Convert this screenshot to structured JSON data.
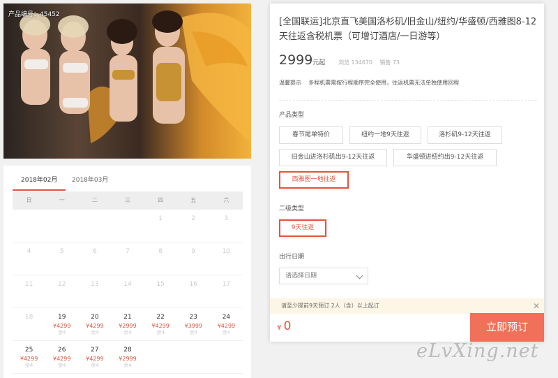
{
  "hero": {
    "product_code": "产品编号：45452"
  },
  "calendar": {
    "tabs": [
      "2018年02月",
      "2018年03月"
    ],
    "weekdays": [
      "日",
      "一",
      "二",
      "三",
      "四",
      "五",
      "六"
    ],
    "rows": [
      [
        {
          "d": ""
        },
        {
          "d": ""
        },
        {
          "d": ""
        },
        {
          "d": ""
        },
        {
          "d": "1"
        },
        {
          "d": "2"
        },
        {
          "d": "3"
        }
      ],
      [
        {
          "d": "4"
        },
        {
          "d": "5"
        },
        {
          "d": "6"
        },
        {
          "d": "7"
        },
        {
          "d": "8"
        },
        {
          "d": "9"
        },
        {
          "d": "10"
        }
      ],
      [
        {
          "d": "11"
        },
        {
          "d": "12"
        },
        {
          "d": "13"
        },
        {
          "d": "14"
        },
        {
          "d": "15"
        },
        {
          "d": "16"
        },
        {
          "d": "17"
        }
      ],
      [
        {
          "d": "18"
        },
        {
          "d": "19",
          "p": "¥4299",
          "r": "余4"
        },
        {
          "d": "20",
          "p": "¥4299",
          "r": "余4"
        },
        {
          "d": "21",
          "p": "¥2999",
          "r": "余4"
        },
        {
          "d": "22",
          "p": "¥4299",
          "r": "余4"
        },
        {
          "d": "23",
          "p": "¥3999",
          "r": "余4"
        },
        {
          "d": "24",
          "p": "¥4299",
          "r": "余4"
        }
      ],
      [
        {
          "d": "25",
          "p": "¥4299",
          "r": "余4"
        },
        {
          "d": "26",
          "p": "¥4299",
          "r": "余4"
        },
        {
          "d": "27",
          "p": "¥4299",
          "r": "余4"
        },
        {
          "d": "28",
          "p": "¥2999",
          "r": "余4"
        },
        {
          "d": ""
        },
        {
          "d": ""
        },
        {
          "d": ""
        }
      ]
    ]
  },
  "product": {
    "title": "[全国联运]北京直飞美国洛杉矶/旧金山/纽约/华盛顿/西雅图8-12天往返含税机票（可增订酒店/一日游等）",
    "price": "2999",
    "price_unit": "元起",
    "views_label": "浏览",
    "views": "134670",
    "sales_label": "销售",
    "sales": "73",
    "tip_label": "温馨提示",
    "tip_text": "多程机票需按行程顺序完全使用，往返机票无法单独使用回程"
  },
  "product_type": {
    "label": "产品类型",
    "options": [
      "春节尾单特价",
      "纽约一地9天往返",
      "洛杉矶9-12天往返",
      "旧金山进洛杉矶出9-12天往返",
      "华盛顿进纽约出9-12天往返",
      "西雅图一地往返"
    ],
    "selected": "西雅图一地往返"
  },
  "sub_type": {
    "label": "二级类型",
    "options": [
      "9天往返"
    ],
    "selected": "9天往返"
  },
  "date": {
    "label": "出行日期",
    "placeholder": "请选择日期"
  },
  "notice": {
    "text": "请至少提前9天预订 2人（含）以上起订",
    "close": "✕"
  },
  "footer": {
    "currency": "¥",
    "total": "0",
    "book_label": "立即预订"
  },
  "watermark": "eLvXing.net",
  "colors": {
    "accent": "#e5533d",
    "button": "#f0705a",
    "notice_bg": "#fdf5e6"
  }
}
